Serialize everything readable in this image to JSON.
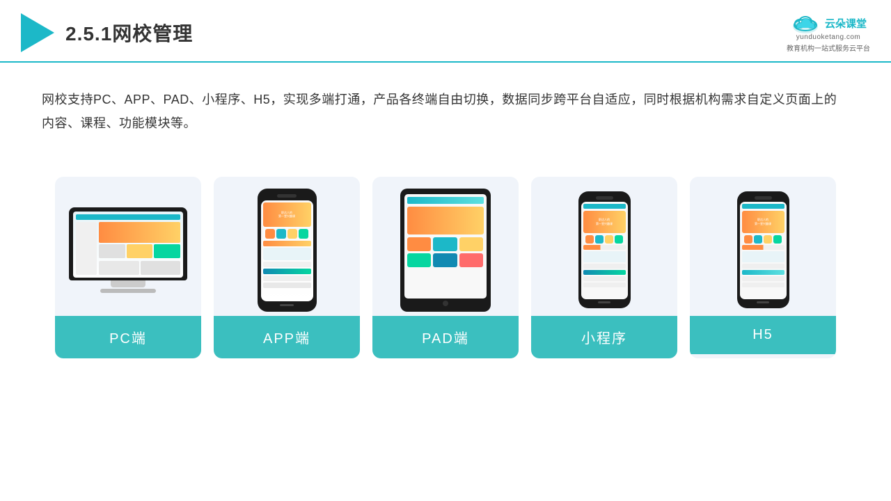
{
  "header": {
    "title": "2.5.1网校管理",
    "logo_cn": "云朵课堂",
    "logo_en": "yunduoketang.com",
    "logo_slogan": "教育机构一站\n式服务云平台"
  },
  "description": {
    "text": "网校支持PC、APP、PAD、小程序、H5，实现多端打通，产品各终端自由切换，数据同步跨平台自适应，同时根据机构需求自定义页面上的内容、课程、功能模块等。"
  },
  "cards": [
    {
      "id": "pc",
      "label": "PC端"
    },
    {
      "id": "app",
      "label": "APP端"
    },
    {
      "id": "pad",
      "label": "PAD端"
    },
    {
      "id": "miniapp",
      "label": "小程序"
    },
    {
      "id": "h5",
      "label": "H5"
    }
  ],
  "colors": {
    "accent": "#1cb8c8",
    "card_bg": "#eef2f8",
    "label_bg": "#3bbfbf",
    "label_text": "#ffffff",
    "text_main": "#333333",
    "header_border": "#1cb8c8"
  }
}
